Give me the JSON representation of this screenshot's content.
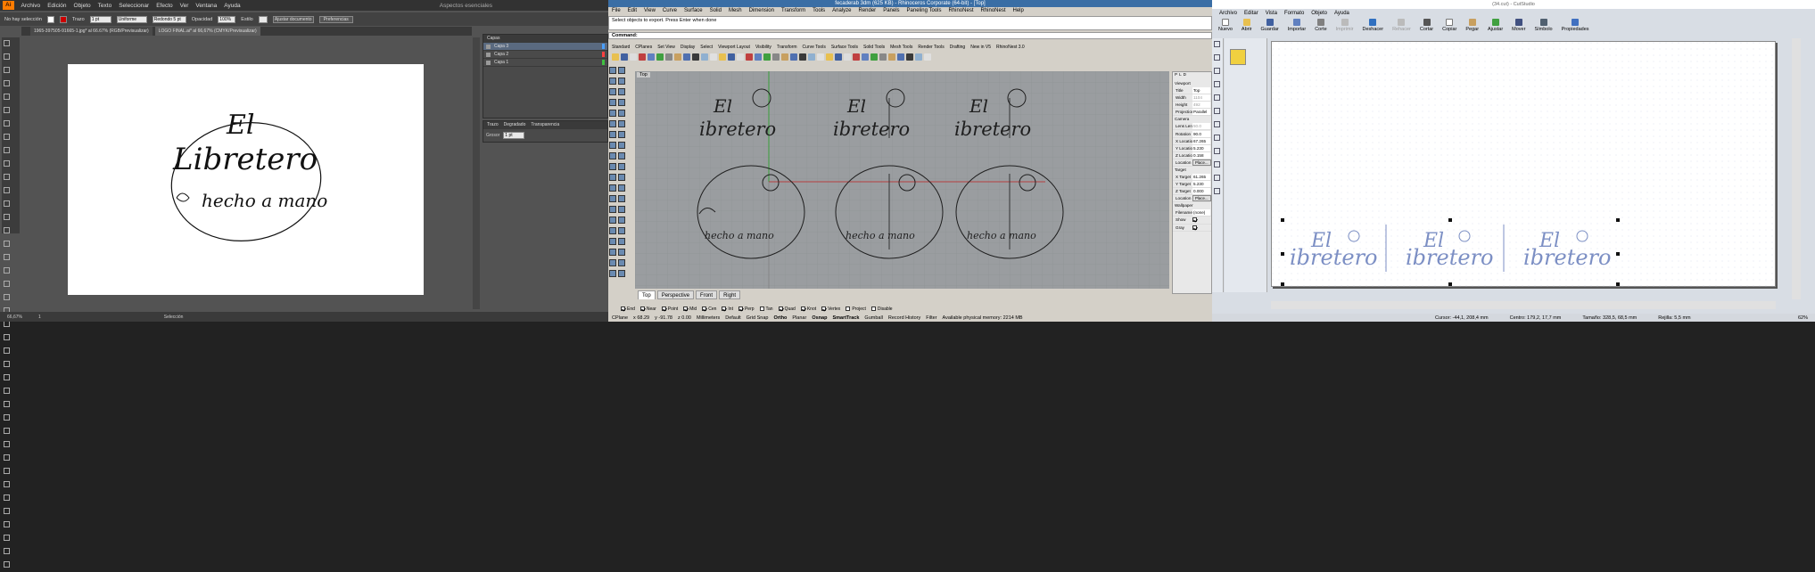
{
  "illustrator": {
    "menu": [
      "Archivo",
      "Edición",
      "Objeto",
      "Texto",
      "Seleccionar",
      "Efecto",
      "Ver",
      "Ventana",
      "Ayuda"
    ],
    "workspace": "Aspectos esenciales",
    "control": {
      "selection": "No hay selección",
      "stroke_label": "Trazo",
      "stroke_value": "1 pt",
      "profile": "Uniforme",
      "brush": "Redondo 5 pt",
      "opacity_label": "Opacidad",
      "opacity_value": "100%",
      "style_label": "Estilo",
      "doc_setup": "Ajustar documento",
      "prefs": "Preferencias"
    },
    "tabs": [
      "1965-397505-91665-1.jpg* al 66.67% (RGB/Previsualizar)",
      "LOGO FINAL.ai* al 66,67% (CMYK/Previsualizar)"
    ],
    "artwork": {
      "line1": "El",
      "line2": "Libretero",
      "line3": "hecho a mano"
    },
    "layers": {
      "title": "Capas",
      "items": [
        "Capa 3",
        "Capa 2",
        "Capa 1"
      ]
    },
    "stroke_panel": {
      "tabs": [
        "Trazo",
        "Degradado",
        "Transparencia"
      ],
      "weight_label": "Grosor",
      "weight_value": "1 pt"
    },
    "status": {
      "zoom": "66,67%",
      "page": "1",
      "tool": "Selección"
    }
  },
  "rhino": {
    "title": "fecaderab 3dm (625 KB) - Rhinoceros Corporate (64-bit) - [Top]",
    "menu": [
      "File",
      "Edit",
      "View",
      "Curve",
      "Surface",
      "Solid",
      "Mesh",
      "Dimension",
      "Transform",
      "Tools",
      "Analyze",
      "Render",
      "Panels",
      "Paneling Tools",
      "RhinoNest",
      "RhinoNest",
      "Help"
    ],
    "cmd_history": "Select objects to export. Press Enter when done",
    "cmd_prompt": "Command:",
    "toolbar_tabs": [
      "Standard",
      "CPlanes",
      "Set View",
      "Display",
      "Select",
      "Viewport Layout",
      "Visibility",
      "Transform",
      "Curve Tools",
      "Surface Tools",
      "Solid Tools",
      "Mesh Tools",
      "Render Tools",
      "Drafting",
      "New in V5",
      "RhinoNest 3.0"
    ],
    "viewport_label": "Top",
    "viewport_tabs": [
      "Top",
      "Perspective",
      "Front",
      "Right"
    ],
    "artwork": {
      "line1": "El",
      "line2": "ibretero",
      "line3": "hecho a mano"
    },
    "props": {
      "tabs": [
        "P",
        "L",
        "D"
      ],
      "viewport": [
        [
          "Title",
          "Top"
        ],
        [
          "Width",
          "1104"
        ],
        [
          "Height",
          "492"
        ],
        [
          "Projection",
          "Parallel"
        ]
      ],
      "camera": [
        [
          "Lens Length",
          "50.0"
        ],
        [
          "Rotation",
          "90.0"
        ],
        [
          "X Location",
          "67.265"
        ],
        [
          "Y Location",
          "5.230"
        ],
        [
          "Z Location",
          "0.158"
        ],
        [
          "Location",
          "Place..."
        ]
      ],
      "target": [
        [
          "X Target",
          "61.265"
        ],
        [
          "Y Target",
          "5.230"
        ],
        [
          "Z Target",
          "0.000"
        ],
        [
          "Location",
          "Place..."
        ]
      ],
      "wallpaper": [
        [
          "Filename",
          "(none)"
        ],
        [
          "Show",
          ""
        ],
        [
          "Gray",
          ""
        ]
      ],
      "sections": [
        "Viewport",
        "Camera",
        "Target",
        "Wallpaper"
      ]
    },
    "osnaps": [
      "End",
      "Near",
      "Point",
      "Mid",
      "Cen",
      "Int",
      "Perp",
      "Tan",
      "Quad",
      "Knot",
      "Vertex",
      "Project",
      "Disable"
    ],
    "status": {
      "cplane": "CPlane",
      "x": "x 68.29",
      "y": "y -91.78",
      "z": "z 0.00",
      "units": "Millimeters",
      "layer": "Default",
      "grid": "Grid Snap",
      "ortho": "Ortho",
      "planar": "Planar",
      "osnap": "Osnap",
      "smart": "SmartTrack",
      "gumball": "Gumball",
      "history": "Record History",
      "filter": "Filter",
      "memory": "Available physical memory: 2214 MB"
    }
  },
  "cutstudio": {
    "title": "(34.cut) - CutStudio",
    "menu": [
      "Archivo",
      "Editar",
      "Vista",
      "Formato",
      "Objeto",
      "Ayuda"
    ],
    "toolbar": [
      "Nuevo",
      "Abrir",
      "Guardar",
      "Importar",
      "Corte",
      "Imprimir",
      "Deshacer",
      "Rehacer",
      "Cortar",
      "Copiar",
      "Pegar",
      "Ajustar",
      "Mover",
      "Símbolo",
      "Propiedades"
    ],
    "artwork": {
      "line1": "El",
      "line2": "ibretero"
    },
    "status": {
      "cursor": "Cursor: -44,1, 208,4 mm",
      "center": "Centro: 179,2, 17,7 mm",
      "size": "Tamaño: 328,5, 68,5 mm",
      "grid": "Rejilla: 5,5 mm",
      "zoom": "62%"
    }
  },
  "colors": {
    "rhino_line": "#1e1e1e",
    "cut_line": "#7c8fc4",
    "ai_orange": "#ff7c00",
    "rhino_axis_red": "#c02020",
    "rhino_axis_green": "#20a020"
  }
}
